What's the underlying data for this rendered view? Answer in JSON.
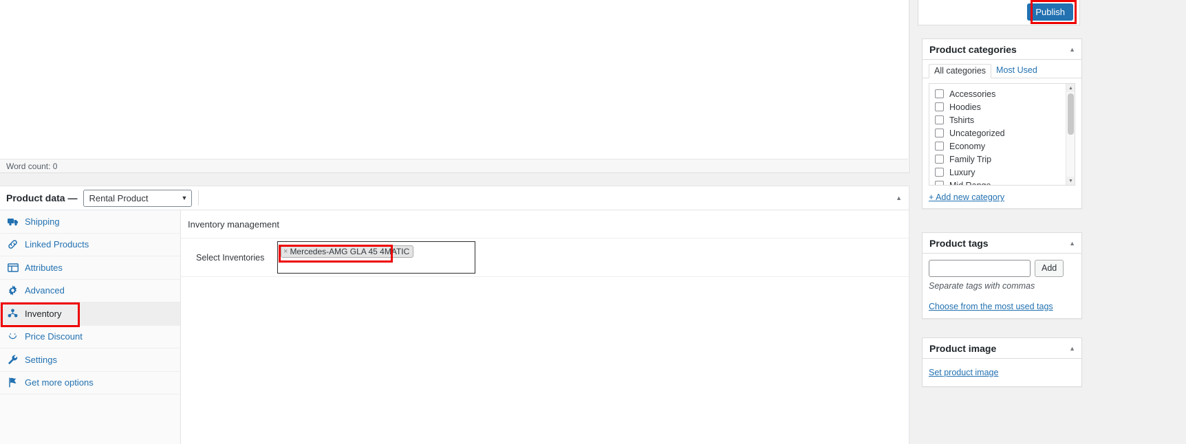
{
  "editor": {
    "word_count_label": "Word count: 0"
  },
  "product_data": {
    "title": "Product data —",
    "selected_type": "Rental Product",
    "type_options": [
      "Rental Product"
    ],
    "toggle_icon": "chevron-up-icon",
    "tabs": [
      {
        "label": "Shipping",
        "icon": "truck-icon",
        "active": false
      },
      {
        "label": "Linked Products",
        "icon": "link-icon",
        "active": false
      },
      {
        "label": "Attributes",
        "icon": "table-icon",
        "active": false
      },
      {
        "label": "Advanced",
        "icon": "gear-icon",
        "active": false
      },
      {
        "label": "Inventory",
        "icon": "inventory-icon",
        "active": true
      },
      {
        "label": "Price Discount",
        "icon": "smiley-icon",
        "active": false
      },
      {
        "label": "Settings",
        "icon": "wrench-icon",
        "active": false
      },
      {
        "label": "Get more options",
        "icon": "flag-icon",
        "active": false
      }
    ],
    "panel": {
      "heading": "Inventory management",
      "field_label": "Select Inventories",
      "selected_tokens": [
        "Mercedes-AMG GLA 45 4MATIC"
      ],
      "token_remove_glyph": "×"
    }
  },
  "sidebar": {
    "publish": {
      "button_label": "Publish"
    },
    "categories": {
      "title": "Product categories",
      "toggle_icon": "chevron-up-icon",
      "tabs": [
        {
          "label": "All categories",
          "active": true
        },
        {
          "label": "Most Used",
          "active": false
        }
      ],
      "items": [
        "Accessories",
        "Hoodies",
        "Tshirts",
        "Uncategorized",
        "Economy",
        "Family Trip",
        "Luxury",
        "Mid Range"
      ],
      "add_new_label": "+ Add new category"
    },
    "tags": {
      "title": "Product tags",
      "toggle_icon": "chevron-up-icon",
      "input_value": "",
      "input_placeholder": "",
      "add_label": "Add",
      "hint": "Separate tags with commas",
      "most_used_label": "Choose from the most used tags"
    },
    "image": {
      "title": "Product image",
      "toggle_icon": "chevron-up-icon",
      "set_label": "Set product image"
    }
  },
  "highlights": {
    "publish_color": "#ee0000",
    "inventory_tab_color": "#ee0000",
    "token_color": "#ee0000"
  }
}
